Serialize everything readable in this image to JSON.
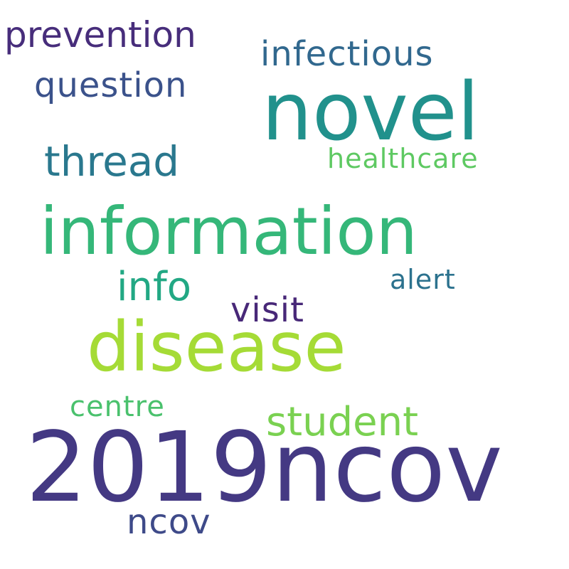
{
  "word_cloud": {
    "words": {
      "w2019ncov": {
        "text": "2019ncov",
        "color": "#443983"
      },
      "novel": {
        "text": "novel",
        "color": "#21918c"
      },
      "disease": {
        "text": "disease",
        "color": "#a5db36"
      },
      "information": {
        "text": "information",
        "color": "#35b779"
      },
      "student": {
        "text": "student",
        "color": "#7ad151"
      },
      "thread": {
        "text": "thread",
        "color": "#2a788e"
      },
      "info": {
        "text": "info",
        "color": "#22a884"
      },
      "prevention": {
        "text": "prevention",
        "color": "#472d7b"
      },
      "question": {
        "text": "question",
        "color": "#3b528b"
      },
      "infectious": {
        "text": "infectious",
        "color": "#31688e"
      },
      "visit": {
        "text": "visit",
        "color": "#482878"
      },
      "ncov": {
        "text": "ncov",
        "color": "#3e4a89"
      },
      "healthcare": {
        "text": "healthcare",
        "color": "#5ec962"
      },
      "centre": {
        "text": "centre",
        "color": "#4ac16d"
      },
      "alert": {
        "text": "alert",
        "color": "#2c728e"
      }
    }
  }
}
